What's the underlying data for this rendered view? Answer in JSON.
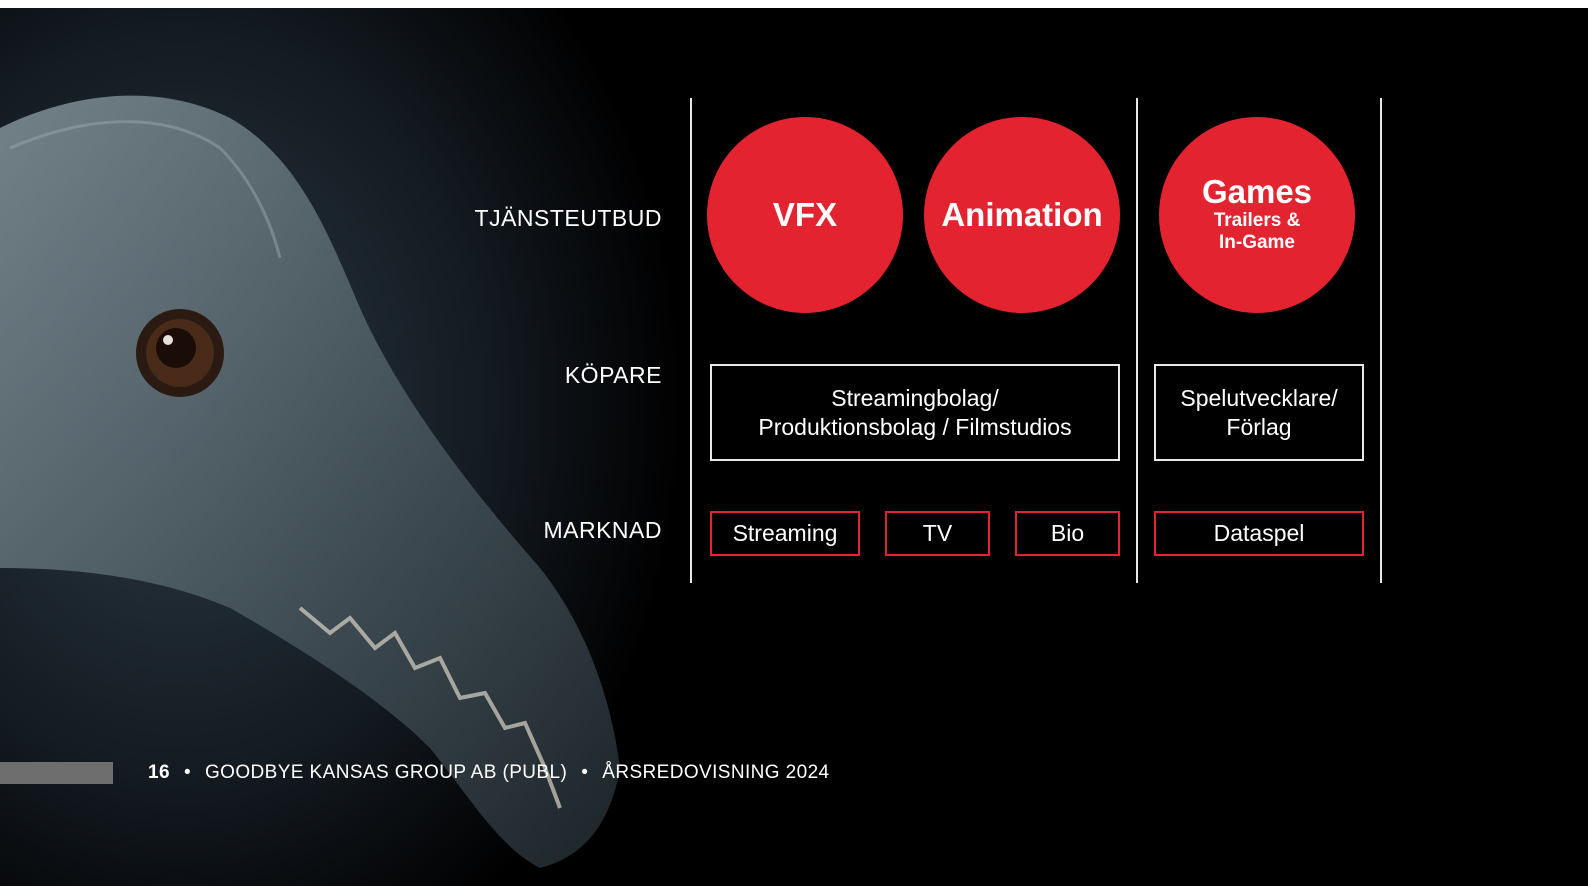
{
  "rows": {
    "services": "TJÄNSTEUTBUD",
    "buyers": "KÖPARE",
    "market": "MARKNAD"
  },
  "services": {
    "vfx": "VFX",
    "animation": "Animation",
    "games_title": "Games",
    "games_sub1": "Trailers &",
    "games_sub2": "In-Game"
  },
  "buyers": {
    "film_line1": "Streamingbolag/",
    "film_line2": "Produktionsbolag / Filmstudios",
    "games_line1": "Spelutvecklare/",
    "games_line2": "Förlag"
  },
  "markets": {
    "streaming": "Streaming",
    "tv": "TV",
    "cinema": "Bio",
    "games": "Dataspel"
  },
  "footer": {
    "page_number": "16",
    "separator": "•",
    "company": "GOODBYE KANSAS GROUP AB (PUBL)",
    "report": "ÅRSREDOVISNING 2024"
  },
  "colors": {
    "accent_red": "#e32430",
    "background": "#000000",
    "line": "#e8e8e8"
  }
}
